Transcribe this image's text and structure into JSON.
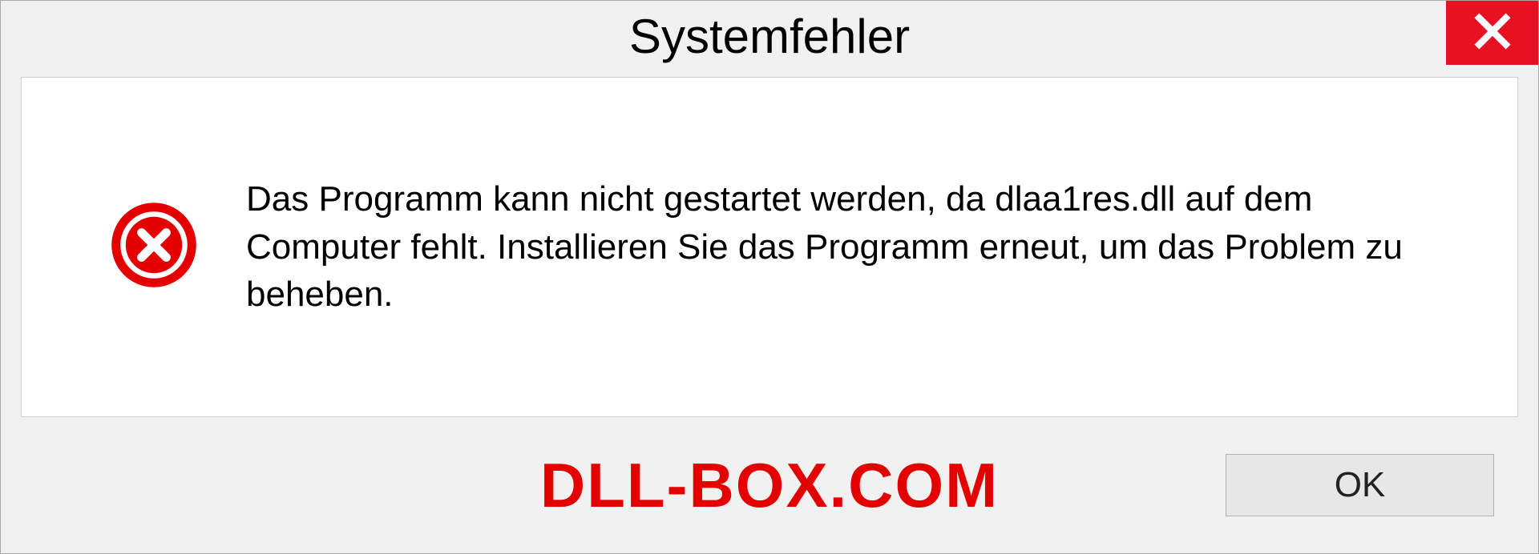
{
  "dialog": {
    "title": "Systemfehler",
    "message": "Das Programm kann nicht gestartet werden, da dlaa1res.dll auf dem Computer fehlt. Installieren Sie das Programm erneut, um das Problem zu beheben.",
    "ok_label": "OK"
  },
  "watermark": "DLL-BOX.COM",
  "colors": {
    "close_btn": "#e81123",
    "error_icon": "#e20000",
    "watermark": "#e20000"
  }
}
